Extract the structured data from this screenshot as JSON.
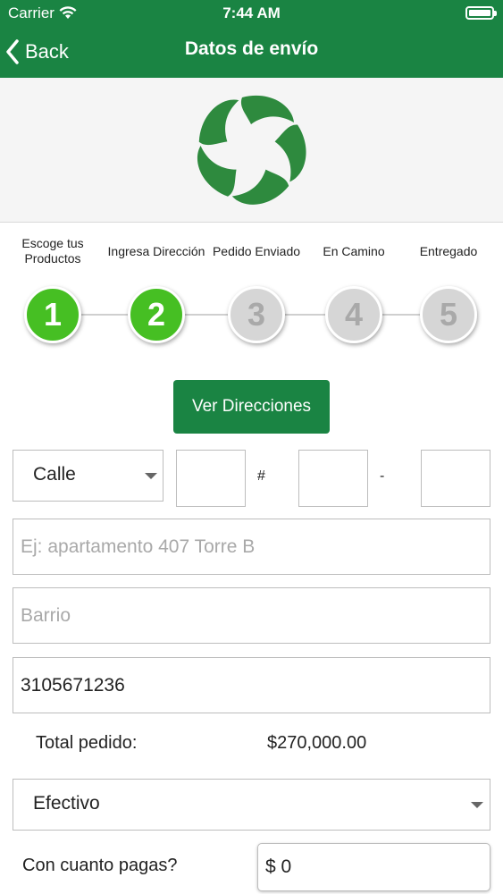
{
  "status_bar": {
    "carrier": "Carrier",
    "time": "7:44 AM"
  },
  "nav": {
    "back_label": "Back",
    "title": "Datos de envío"
  },
  "colors": {
    "brand": "#1a8443",
    "step_done": "#46bf23",
    "step_pending": "#d6d6d6"
  },
  "steps": [
    {
      "label": "Escoge tus Productos",
      "number": "1",
      "state": "done"
    },
    {
      "label": "Ingresa Dirección",
      "number": "2",
      "state": "done"
    },
    {
      "label": "Pedido Enviado",
      "number": "3",
      "state": "pending"
    },
    {
      "label": "En Camino",
      "number": "4",
      "state": "pending"
    },
    {
      "label": "Entregado",
      "number": "5",
      "state": "pending"
    }
  ],
  "ver_direcciones_label": "Ver Direcciones",
  "address": {
    "street_type": "Calle",
    "hash_separator": "#",
    "dash_separator": "-",
    "number1": "",
    "number2": "",
    "number3": "",
    "detail_placeholder": "Ej: apartamento 407 Torre B",
    "barrio_placeholder": "Barrio",
    "phone": "3105671236"
  },
  "total": {
    "label": "Total pedido:",
    "value": "$270,000.00"
  },
  "payment": {
    "method": "Efectivo"
  },
  "cash": {
    "label": "Con cuanto pagas?",
    "value": "$ 0"
  }
}
